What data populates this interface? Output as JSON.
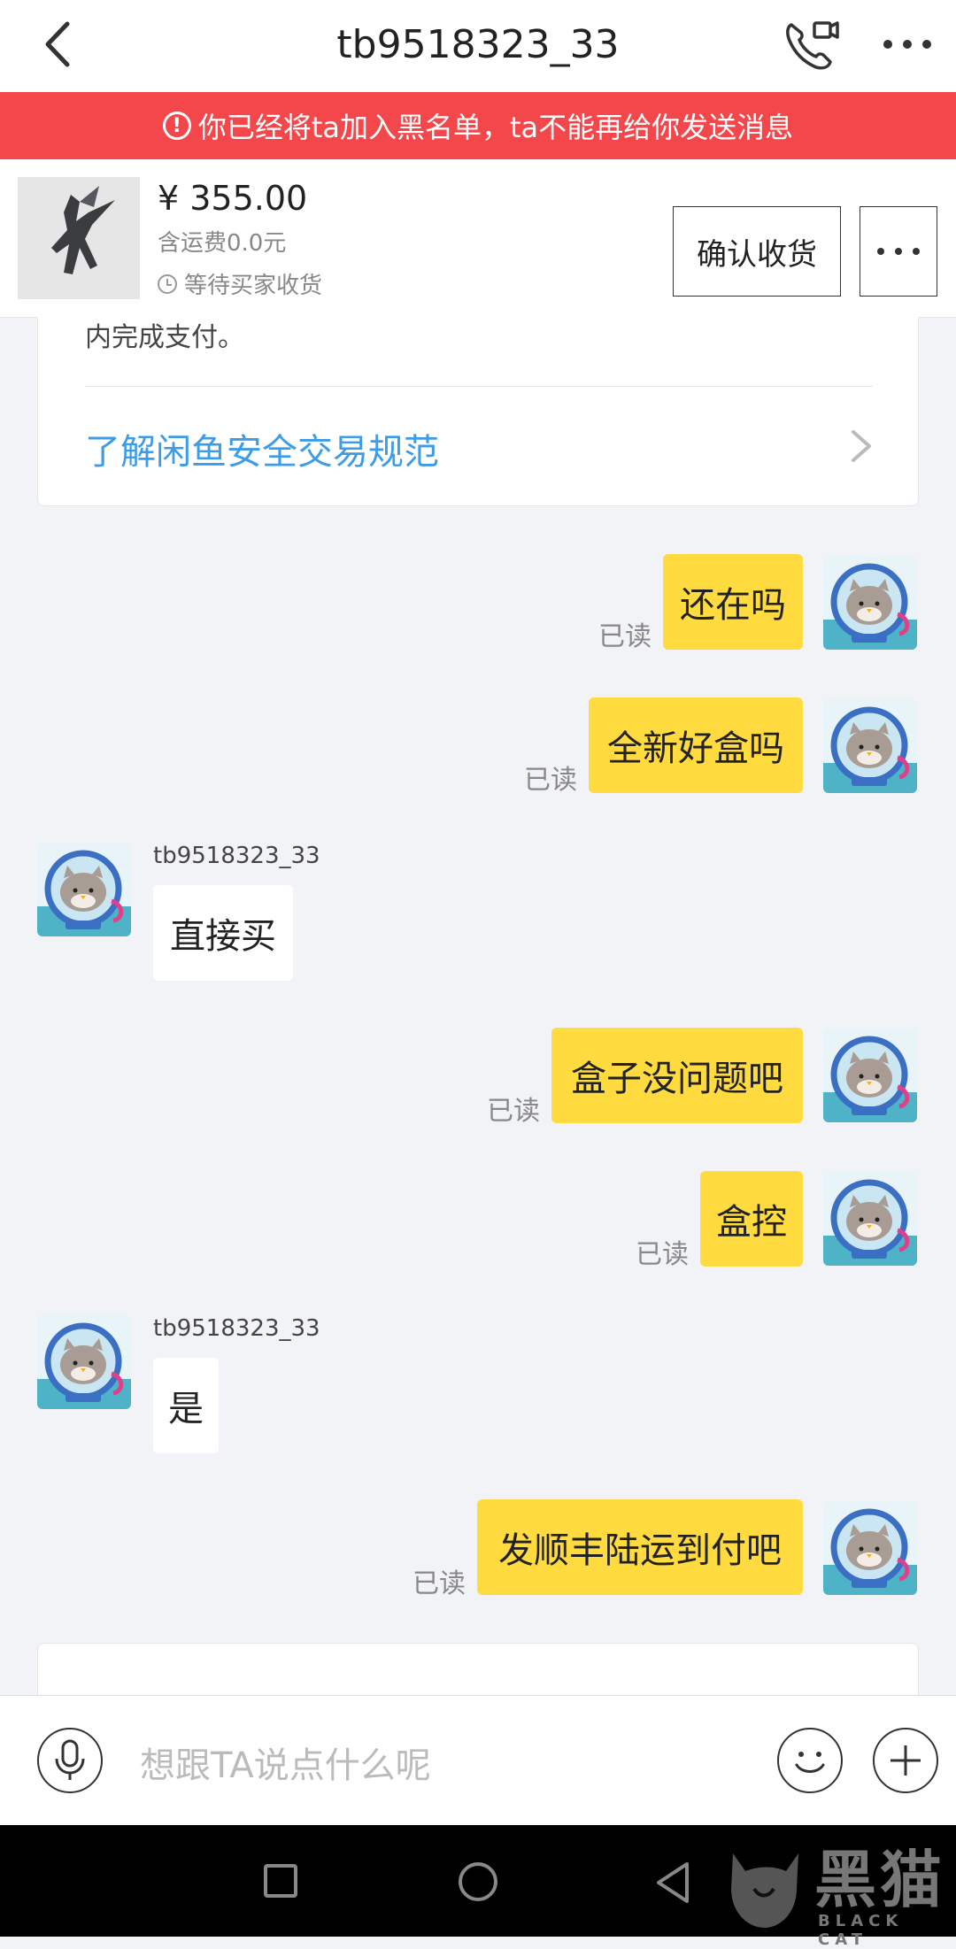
{
  "header": {
    "title": "tb9518323_33"
  },
  "banner": {
    "text": "你已经将ta加入黑名单，ta不能再给你发送消息"
  },
  "product": {
    "price": "¥ 355.00",
    "shipping": "含运费0.0元",
    "status": "等待买家收货",
    "confirm_label": "确认收货"
  },
  "info_card": {
    "partial_text": "内完成支付。",
    "link_text": "了解闲鱼安全交易规范"
  },
  "messages": [
    {
      "side": "right",
      "text": "还在吗",
      "status": "已读"
    },
    {
      "side": "right",
      "text": "全新好盒吗",
      "status": "已读"
    },
    {
      "side": "left",
      "sender": "tb9518323_33",
      "text": "直接买"
    },
    {
      "side": "right",
      "text": "盒子没问题吧",
      "status": "已读"
    },
    {
      "side": "right",
      "text": "盒控",
      "status": "已读"
    },
    {
      "side": "left",
      "sender": "tb9518323_33",
      "text": "是"
    },
    {
      "side": "right",
      "text": "发顺丰陆运到付吧",
      "status": "已读"
    }
  ],
  "input": {
    "placeholder": "想跟TA说点什么呢"
  },
  "watermark": {
    "big": "黑猫",
    "small": "BLACK CAT"
  },
  "colors": {
    "banner": "#f4474b",
    "bubble_self": "#ffdb3f",
    "link": "#3d9ce8",
    "background": "#f2f3f7"
  },
  "icons": [
    "back-arrow-icon",
    "phone-video-icon",
    "more-dots-icon",
    "alert-icon",
    "clock-icon",
    "chevron-right-icon",
    "microphone-icon",
    "emoji-icon",
    "plus-icon"
  ]
}
